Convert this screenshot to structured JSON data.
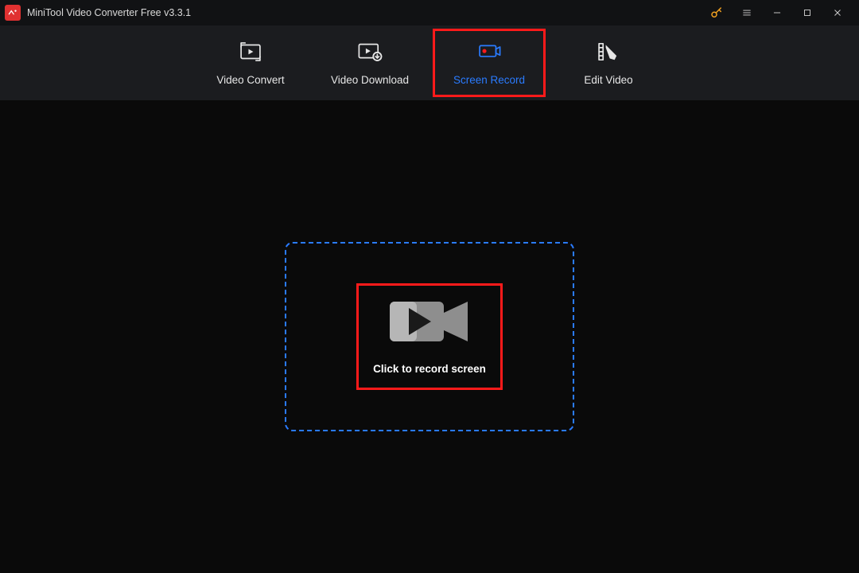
{
  "titlebar": {
    "title": "MiniTool Video Converter Free v3.3.1"
  },
  "tabs": {
    "items": [
      {
        "label": "Video Convert"
      },
      {
        "label": "Video Download"
      },
      {
        "label": "Screen Record"
      },
      {
        "label": "Edit Video"
      }
    ]
  },
  "main": {
    "record_button_label": "Click to record screen"
  }
}
